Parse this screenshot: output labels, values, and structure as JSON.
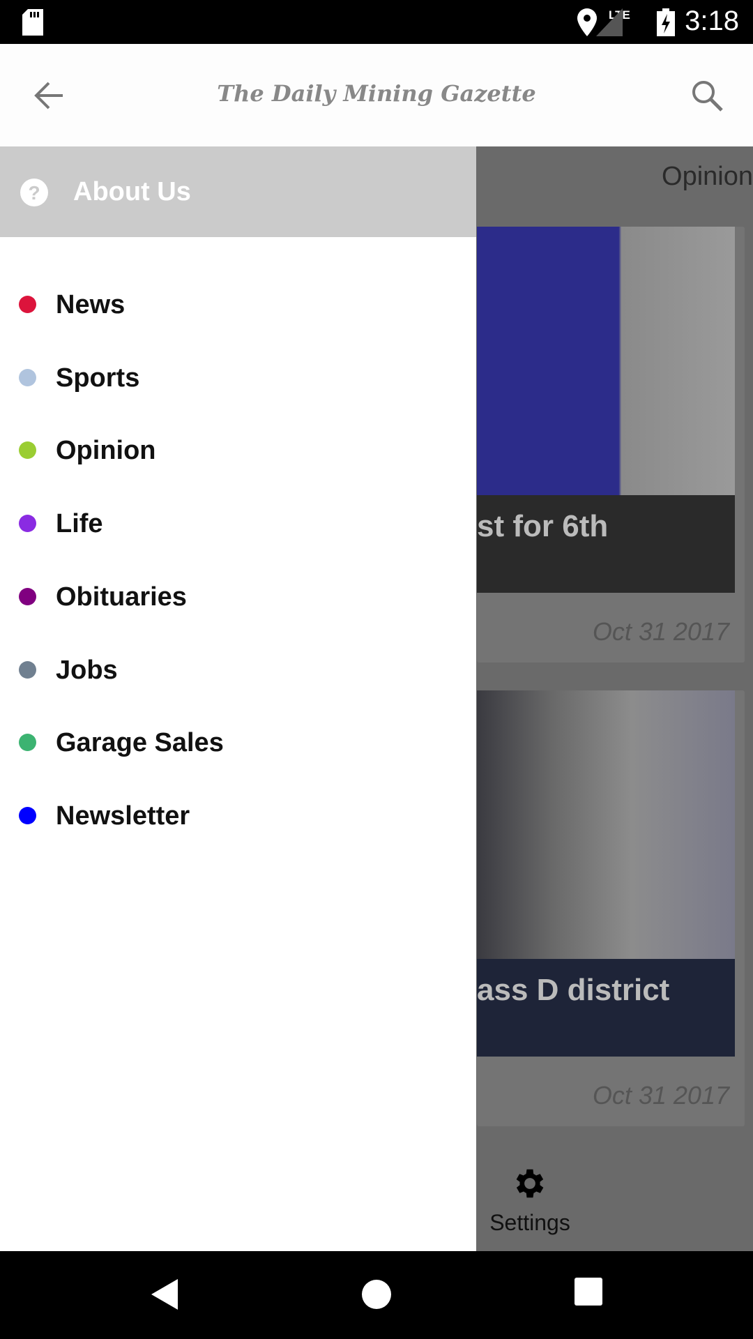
{
  "status_bar": {
    "time": "3:18",
    "network": "LTE",
    "icons": [
      "sd-card-icon",
      "location-icon",
      "signal-icon",
      "battery-charging-icon"
    ]
  },
  "app_bar": {
    "title": "The Daily Mining Gazette",
    "back_icon": "arrow-left-icon",
    "search_icon": "search-icon"
  },
  "background": {
    "tab": "Opinion",
    "cards": [
      {
        "headline": "st for 6th",
        "date": "Oct 31 2017"
      },
      {
        "headline": "ass D district",
        "date": "Oct 31 2017"
      }
    ],
    "settings_label": "Settings"
  },
  "drawer": {
    "header": {
      "label": "About Us",
      "icon": "help-circle-icon"
    },
    "items": [
      {
        "label": "News",
        "color": "#dc143c"
      },
      {
        "label": "Sports",
        "color": "#b0c4de"
      },
      {
        "label": "Opinion",
        "color": "#9acd32"
      },
      {
        "label": "Life",
        "color": "#8a2be2"
      },
      {
        "label": "Obituaries",
        "color": "#800080"
      },
      {
        "label": "Jobs",
        "color": "#708090"
      },
      {
        "label": "Garage Sales",
        "color": "#3cb371"
      },
      {
        "label": "Newsletter",
        "color": "#0000ff"
      }
    ]
  }
}
